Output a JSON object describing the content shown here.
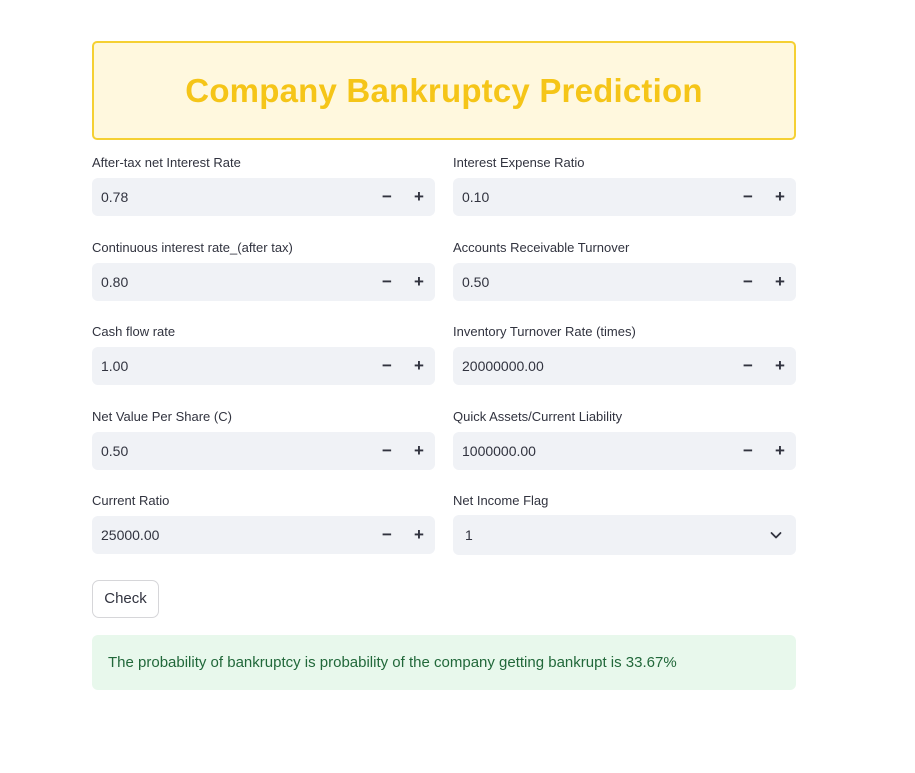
{
  "header": {
    "title": "Company Bankruptcy Prediction"
  },
  "fields": [
    {
      "label": "After-tax net Interest Rate",
      "value": "0.78"
    },
    {
      "label": "Interest Expense Ratio",
      "value": "0.10"
    },
    {
      "label": "Continuous interest rate_(after tax)",
      "value": "0.80"
    },
    {
      "label": "Accounts Receivable Turnover",
      "value": "0.50"
    },
    {
      "label": "Cash flow rate",
      "value": "1.00"
    },
    {
      "label": "Inventory Turnover Rate (times)",
      "value": "20000000.00"
    },
    {
      "label": "Net Value Per Share (C)",
      "value": "0.50"
    },
    {
      "label": "Quick Assets/Current Liability",
      "value": "1000000.00"
    },
    {
      "label": "Current Ratio",
      "value": "25000.00"
    }
  ],
  "select": {
    "label": "Net Income Flag",
    "value": "1"
  },
  "stepper": {
    "minus": "−",
    "plus": "+"
  },
  "actions": {
    "check_label": "Check"
  },
  "result": {
    "text": "The probability of bankruptcy is probability of the company getting bankrupt is 33.67%"
  },
  "colors": {
    "title": "#f5c518",
    "title_border": "#f5d033",
    "title_bg": "#fff8de",
    "input_bg": "#f0f2f6",
    "success_bg": "#e8f8ec",
    "success_text": "#21683a"
  }
}
